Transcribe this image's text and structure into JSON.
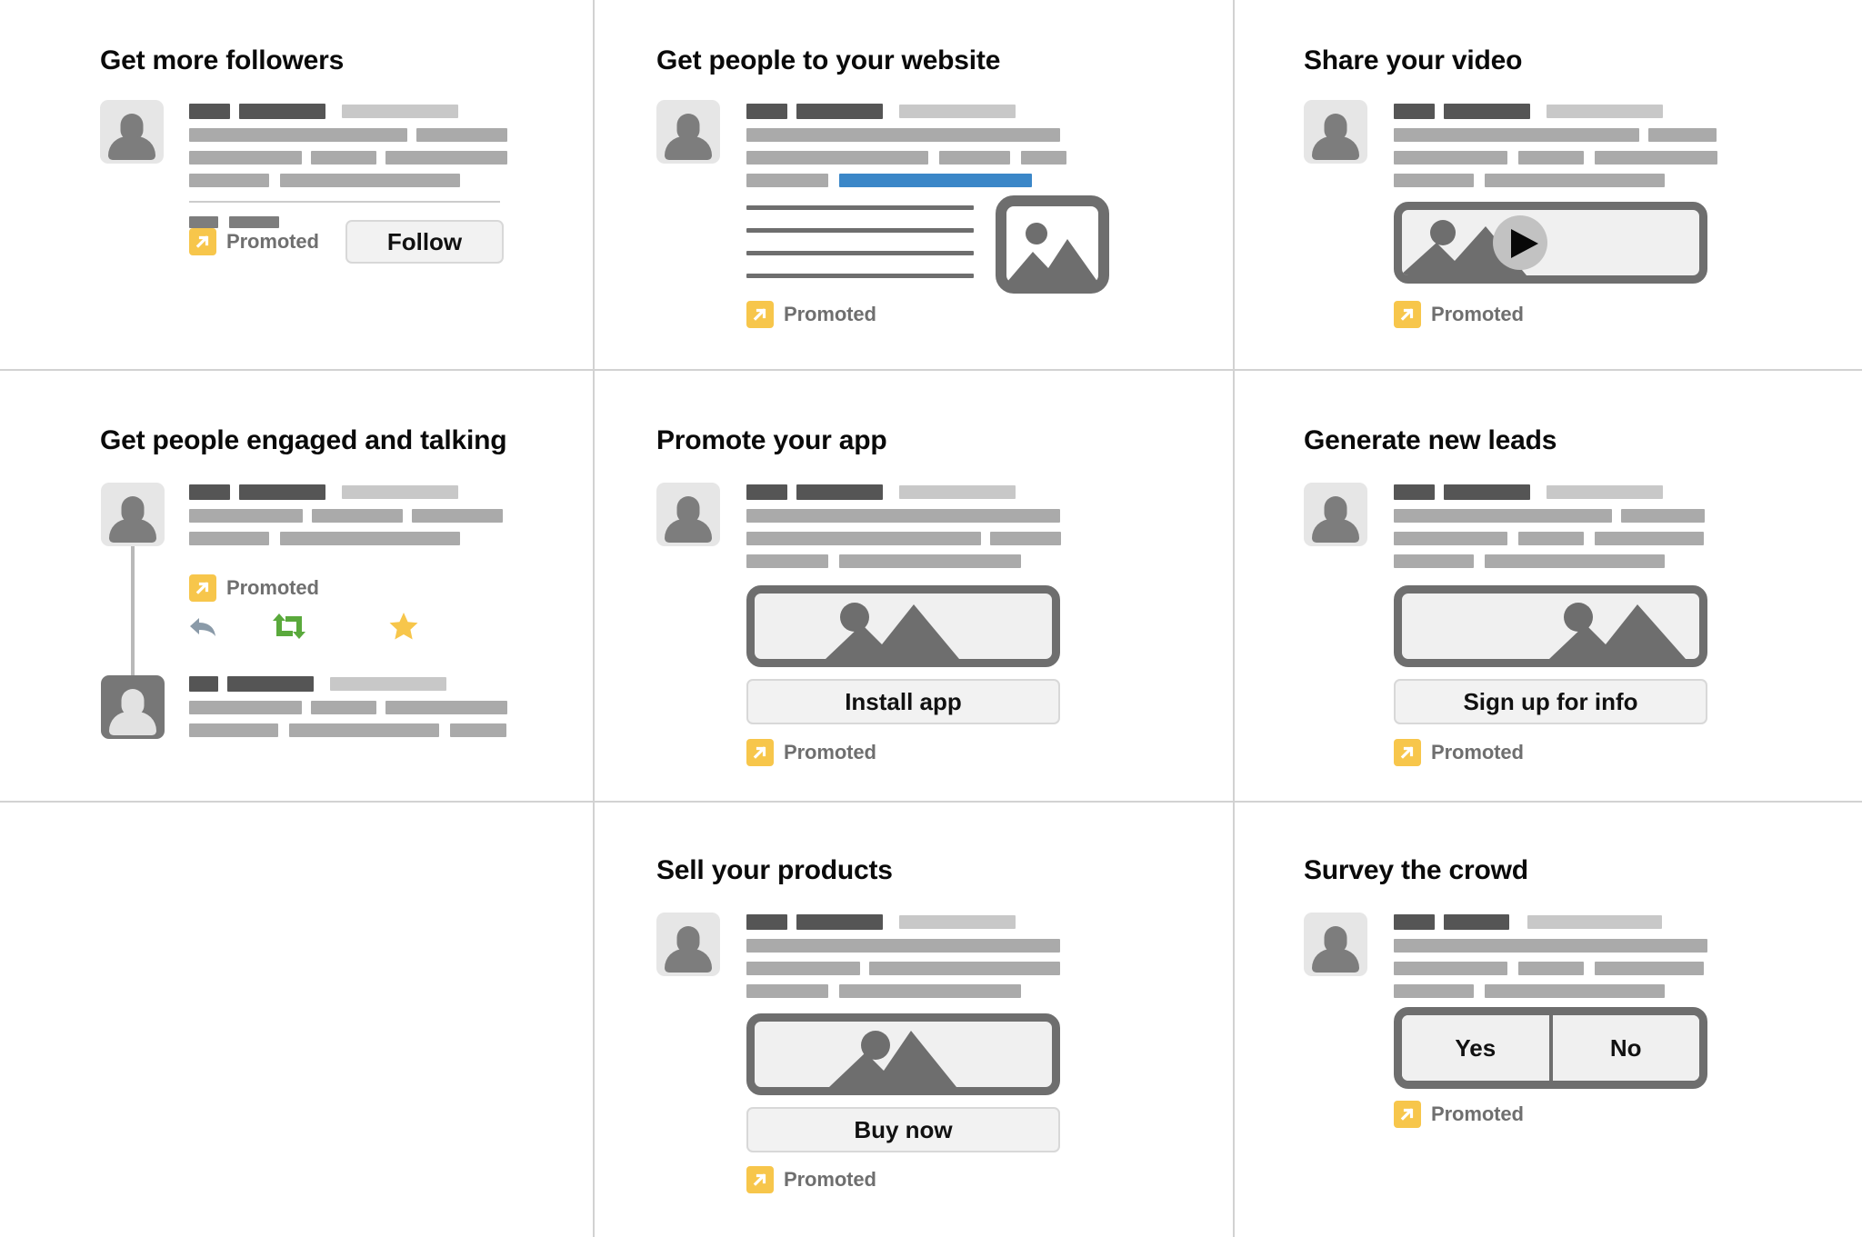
{
  "meta": {
    "colors": {
      "promoted_yellow": "#f7c64b",
      "link_blue": "#3b87c8",
      "retweet_green": "#5aa93c",
      "reply_blue": "#8a9aa8",
      "star_yellow": "#f7c64b",
      "frame_gray": "#6e6e6e",
      "grid_line": "#d2d2d2"
    },
    "promoted_label": "Promoted"
  },
  "panels": [
    {
      "id": "get-more-followers",
      "title": "Get more followers",
      "promoted": "Promoted",
      "button": "Follow",
      "icons": []
    },
    {
      "id": "get-people-to-your-website",
      "title": "Get people to your website",
      "promoted": "Promoted",
      "button": null,
      "icons": [
        "photo-icon"
      ]
    },
    {
      "id": "share-your-video",
      "title": "Share your video",
      "promoted": "Promoted",
      "button": null,
      "icons": [
        "play-icon",
        "photo-icon"
      ]
    },
    {
      "id": "get-people-engaged-and-talking",
      "title": "Get people engaged and talking",
      "promoted": "Promoted",
      "button": null,
      "icons": [
        "reply-icon",
        "retweet-icon",
        "star-icon"
      ]
    },
    {
      "id": "promote-your-app",
      "title": "Promote your app",
      "promoted": "Promoted",
      "button": "Install app",
      "icons": [
        "photo-icon"
      ]
    },
    {
      "id": "generate-new-leads",
      "title": "Generate new leads",
      "promoted": "Promoted",
      "button": "Sign up for info",
      "icons": [
        "photo-icon"
      ]
    },
    {
      "id": "sell-your-products",
      "title": "Sell your products",
      "promoted": "Promoted",
      "button": "Buy now",
      "icons": [
        "photo-icon"
      ]
    },
    {
      "id": "survey-the-crowd",
      "title": "Survey the crowd",
      "promoted": "Promoted",
      "buttons": [
        "Yes",
        "No"
      ],
      "icons": []
    }
  ]
}
